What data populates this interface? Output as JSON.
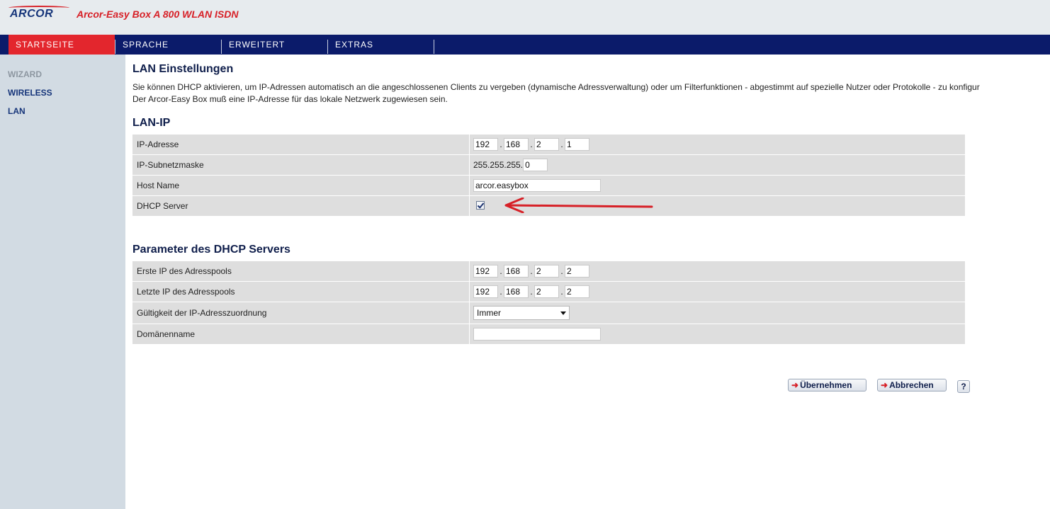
{
  "header": {
    "logo_text": "ARCOR",
    "product_title": "Arcor-Easy Box A 800 WLAN ISDN"
  },
  "topnav": {
    "tabs": [
      {
        "label": "STARTSEITE",
        "active": true
      },
      {
        "label": "SPRACHE",
        "active": false
      },
      {
        "label": "ERWEITERT",
        "active": false
      },
      {
        "label": "EXTRAS",
        "active": false
      }
    ]
  },
  "sidebar": {
    "items": [
      {
        "label": "WIZARD"
      },
      {
        "label": "WIRELESS"
      },
      {
        "label": "LAN"
      }
    ]
  },
  "main": {
    "title": "LAN Einstellungen",
    "intro_line1": "Sie können DHCP aktivieren, um IP-Adressen automatisch an die angeschlossenen Clients zu vergeben (dynamische Adressverwaltung) oder um Filterfunktionen - abgestimmt auf spezielle Nutzer oder Protokolle - zu konfigur",
    "intro_line2": "Der Arcor-Easy Box muß eine IP-Adresse für das lokale Netzwerk zugewiesen sein.",
    "lan_ip": {
      "heading": "LAN-IP",
      "ip_label": "IP-Adresse",
      "ip": [
        "192",
        "168",
        "2",
        "1"
      ],
      "subnet_label": "IP-Subnetzmaske",
      "subnet_prefix": "255.255.255.",
      "subnet_last": "0",
      "host_label": "Host Name",
      "host_value": "arcor.easybox",
      "dhcp_label": "DHCP Server",
      "dhcp_checked": true
    },
    "dhcp_params": {
      "heading": "Parameter des DHCP Servers",
      "first_ip_label": "Erste IP des Adresspools",
      "first_ip": [
        "192",
        "168",
        "2",
        "2"
      ],
      "last_ip_label": "Letzte IP des Adresspools",
      "last_ip": [
        "192",
        "168",
        "2",
        "2"
      ],
      "lease_label": "Gültigkeit der IP-Adresszuordnung",
      "lease_value": "Immer",
      "domain_label": "Domänenname",
      "domain_value": ""
    },
    "buttons": {
      "apply": "Übernehmen",
      "cancel": "Abbrechen",
      "help": "?"
    }
  },
  "colors": {
    "nav_bg": "#0b1b6a",
    "active_tab": "#e3262d",
    "sidebar_bg": "#d2dbe3",
    "row_bg": "#dedede",
    "heading": "#0f1e4b",
    "annotation_arrow": "#d72027"
  }
}
